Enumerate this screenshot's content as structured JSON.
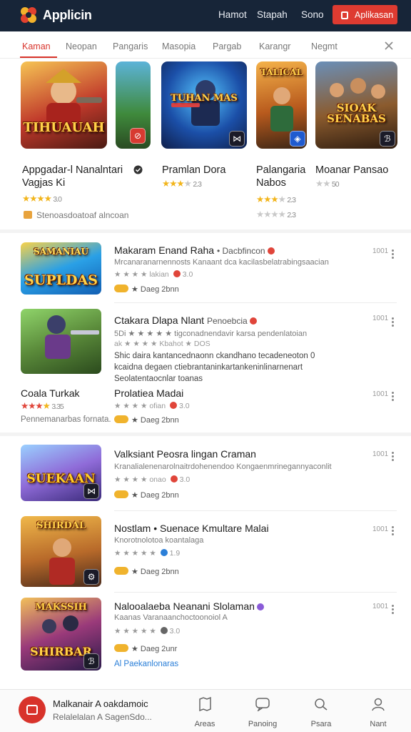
{
  "header": {
    "app_title": "Applicin",
    "nav": [
      "Hamot",
      "Stapah",
      "Sono"
    ],
    "cta_label": "Aplikasan",
    "colors": {
      "background": "#172538",
      "accent": "#de3b31"
    }
  },
  "tabs": [
    "Kaman",
    "Neopan",
    "Pangaris",
    "Masopia",
    "Pargab",
    "Karangr",
    "Negmt"
  ],
  "featured": [
    {
      "title": "Appgadar-l Nanalntari",
      "subtitle": "Vagjas Ki",
      "stars": 4,
      "rating": "3.0",
      "art": "TIHUAUAH"
    },
    {
      "title": "Pramlan Dora",
      "stars": 3,
      "rating": "2.3",
      "art": "TUHAN MAS"
    },
    {
      "title": "Palangaria",
      "subtitle": "Nabos",
      "stars": 3,
      "rating": "2.3",
      "rating2": "2.3",
      "art": "TALICAL"
    },
    {
      "title": "Moanar Pansao",
      "stars": 2,
      "rating": "50",
      "art": "SIOAK SENABAS"
    }
  ],
  "promo_text": "Stenoasdoatoaf alncoan",
  "list": [
    {
      "title": "Makaram Enand Raha",
      "suffix": "• Dacbfincon",
      "sub": "Mrcanaranarnennosts Kanaant dca kacilasbelatrabingsaacian",
      "stars_text": "★ ★ ★ ★ lakian",
      "rating": "3.0",
      "tag": "★ Daeg 2bnn",
      "count": "1001",
      "art": "SUPLDAS"
    },
    {
      "title": "Ctakara Dlapa Nlant",
      "suffix": "Penoebcia",
      "sub": "5Di ★ ★ ★ ★ ★ tigconadnendavir karsa pendenlatoian",
      "stars_text": "ak ★ ★ ★ ★ Kbahot ★",
      "rating": "DOS",
      "desc": "Shic daira kantancednaonn ckandhano tecadeneoton 0 kcaidna degaen ctiebrantaninkartankeninlinarnenart Seolatentaocnlar toanas",
      "count": "1001",
      "art": ""
    },
    {
      "title": "Prolatiea Madai",
      "left_title": "Coala Turkak",
      "left_sub": "Pennemanarbas fornata.",
      "stars_text": "★ ★ ★ ★ ofian",
      "rating": "3.0",
      "tag": "★ Daeg 2bnn",
      "count": "1001",
      "art": ""
    },
    {
      "title": "Valksiant Peosra lingan Craman",
      "sub": "Kranalialenenarolnaitrdohenendoo Kongaenmrinegannyaconlit",
      "stars_text": "★ ★ ★ ★ onao",
      "rating": "3.0",
      "tag": "★ Daeg 2bnn",
      "count": "1001",
      "art": "SUEKAAN"
    },
    {
      "title": "Nostlam • Suenace Kmultare Malai",
      "sub": "Knorotnolotoa koantalaga",
      "stars_text": "★ ★ ★ ★ ★",
      "rating": "1.9",
      "tag": "★ Daeg 2bnn",
      "count": "1001",
      "art": "SHIRDAL"
    },
    {
      "title": "Nalooalaeba Neanani Slolaman",
      "sub": "Kaanas Varanaanchoctoonoiol A",
      "stars_text": "★ ★ ★ ★ ★",
      "rating": "3.0",
      "tag": "★ Daeg 2unr",
      "count": "1001",
      "more": "Al Paekanlonaras",
      "art": "SHIRBAR"
    }
  ],
  "bottom": {
    "title": "Malkanair A oakdamoic",
    "sub": "Relalelalan A SagenSdo...",
    "nav": [
      "Areas",
      "Panoing",
      "Psara",
      "Nant"
    ]
  }
}
